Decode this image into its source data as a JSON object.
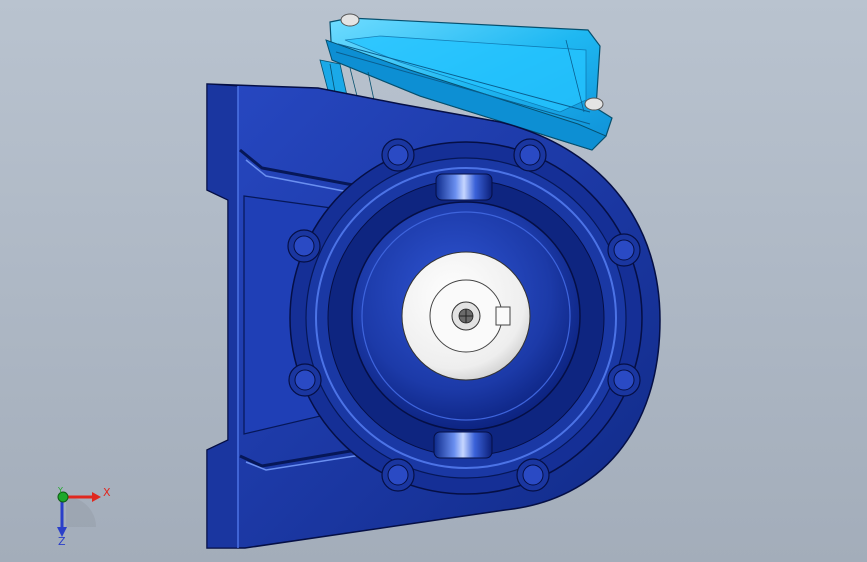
{
  "viewport": {
    "background_top": "#b9c3cf",
    "background_bottom": "#a3adba"
  },
  "model": {
    "body_color": "#1c3aa8",
    "body_dark": "#0b1f78",
    "body_light": "#3b62d9",
    "motor_color": "#1fb8f2",
    "motor_dark": "#0a73b8",
    "shaft_color": "#f4f4f4"
  },
  "triad": {
    "x_label": "X",
    "y_label": "Y",
    "z_label": "Z",
    "x_color": "#e0281f",
    "y_color": "#1ea82a",
    "z_color": "#2a3fc9"
  }
}
